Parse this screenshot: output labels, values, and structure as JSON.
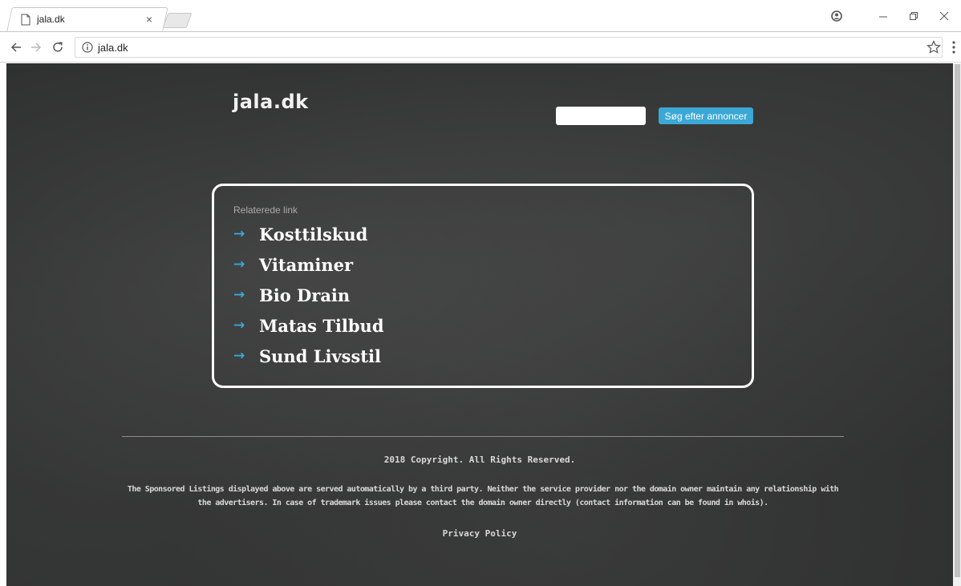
{
  "browser": {
    "tab_title": "jala.dk",
    "tab_close": "×",
    "address": "jala.dk"
  },
  "page": {
    "logo": "jala.dk",
    "search": {
      "value": "",
      "button_label": "Søg efter annoncer"
    },
    "related": {
      "heading": "Relaterede link",
      "links": [
        "Kosttilskud",
        "Vitaminer",
        "Bio Drain",
        "Matas Tilbud",
        "Sund Livsstil"
      ]
    },
    "footer": {
      "copyright": "2018 Copyright. All Rights Reserved.",
      "disclaimer": "The Sponsored Listings displayed above are served automatically by a third party. Neither the service provider nor the domain owner maintain any relationship with the advertisers. In case of trademark issues please contact the domain owner directly (contact information can be found in whois).",
      "privacy_label": "Privacy Policy"
    }
  },
  "colors": {
    "accent": "#3ba8d6",
    "background": "#303131",
    "text": "#ffffff"
  },
  "icons": {
    "link_arrow": "→"
  }
}
